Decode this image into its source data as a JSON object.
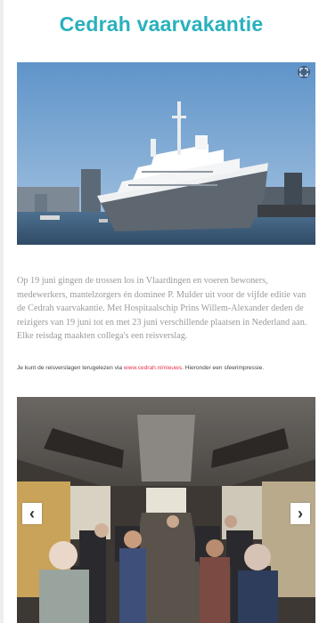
{
  "header": {
    "title": "Cedrah vaarvakantie"
  },
  "hero": {
    "image_name": "cruise-ship-photo",
    "expand_icon": "expand-icon"
  },
  "article": {
    "intro": "Op 19 juni gingen de trossen los in Vlaardingen en voeren bewoners, medewerkers, mantelzorgers én dominee P. Mulder uit voor de vijfde editie van de Cedrah vaarvakantie. Met Hospitaalschip Prins Willem-Alexander deden de reizigers van 19 juni tot en met 23 juni verschillende plaatsen in Nederland aan. Elke reisdag maakten collega's een reisverslag.",
    "note_before": "Je kunt de reisverslagen terugelezen via ",
    "note_link": "www.cedrah.nl/nieuws",
    "note_after": ". Hieronder een sfeerimpressie."
  },
  "gallery": {
    "prev_label": "‹",
    "next_label": "›",
    "image_name": "bus-passengers-photo"
  },
  "colors": {
    "title": "#29b1bd",
    "link": "#e5334b",
    "body_text": "#9a9a9a"
  }
}
